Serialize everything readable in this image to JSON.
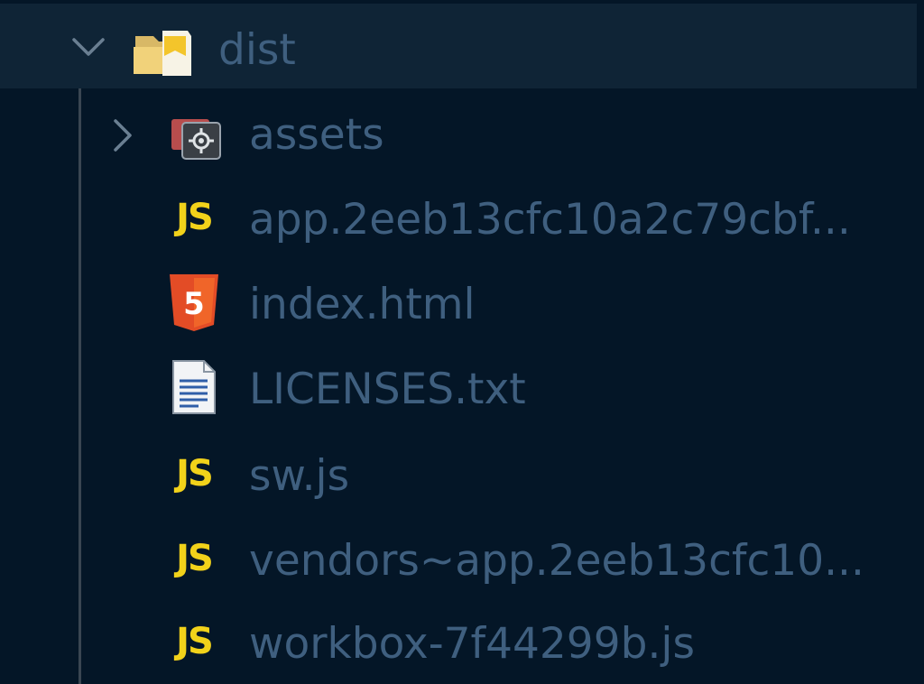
{
  "explorer": {
    "root": {
      "label": "dist",
      "expanded": true,
      "icon": "folder-dist-open-icon"
    },
    "items": [
      {
        "label": "assets",
        "icon": "folder-assets-icon",
        "type": "folder",
        "expanded": false
      },
      {
        "label": "app.2eeb13cfc10a2c79cbf...",
        "icon": "javascript-file-icon",
        "icon_text": "JS",
        "type": "file"
      },
      {
        "label": "index.html",
        "icon": "html5-file-icon",
        "icon_text": "5",
        "type": "file"
      },
      {
        "label": "LICENSES.txt",
        "icon": "text-file-icon",
        "type": "file"
      },
      {
        "label": "sw.js",
        "icon": "javascript-file-icon",
        "icon_text": "JS",
        "type": "file"
      },
      {
        "label": "vendors~app.2eeb13cfc10...",
        "icon": "javascript-file-icon",
        "icon_text": "JS",
        "type": "file"
      },
      {
        "label": "workbox-7f44299b.js",
        "icon": "javascript-file-icon",
        "icon_text": "JS",
        "type": "file"
      }
    ]
  },
  "colors": {
    "background": "#041627",
    "selected_row": "#0f2436",
    "label": "#3f5f7f",
    "js_icon": "#f2d21a",
    "html_icon": "#e34c26"
  }
}
